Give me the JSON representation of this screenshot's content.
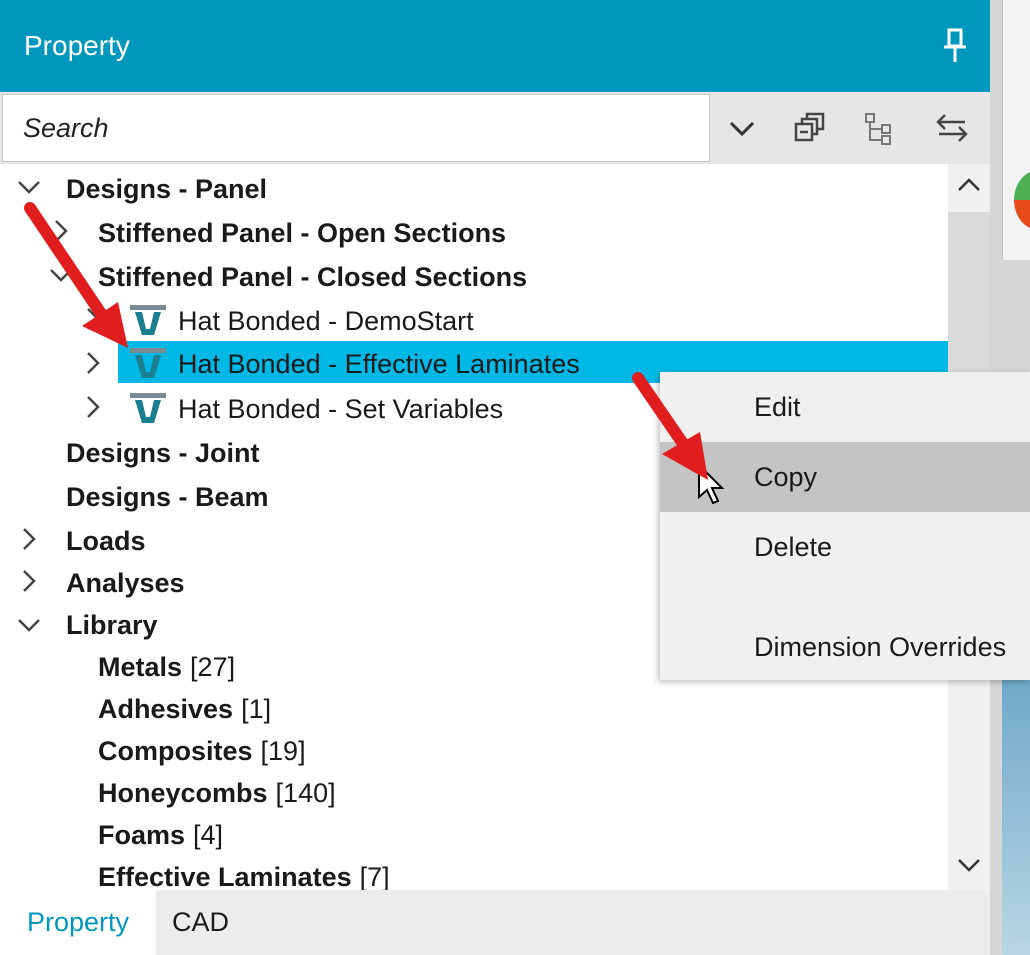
{
  "panel": {
    "title": "Property"
  },
  "search": {
    "placeholder": "Search"
  },
  "tree": {
    "designs_panel": "Designs - Panel",
    "open_sections": "Stiffened Panel - Open Sections",
    "closed_sections": "Stiffened Panel - Closed Sections",
    "hat_demostart": "Hat Bonded - DemoStart",
    "hat_effective": "Hat Bonded - Effective Laminates",
    "hat_setvars": "Hat Bonded - Set Variables",
    "designs_joint": "Designs - Joint",
    "designs_beam": "Designs - Beam",
    "loads": "Loads",
    "analyses": "Analyses",
    "library": "Library",
    "library_items": [
      {
        "label": "Metals",
        "count": "[27]"
      },
      {
        "label": "Adhesives",
        "count": "[1]"
      },
      {
        "label": "Composites",
        "count": "[19]"
      },
      {
        "label": "Honeycombs",
        "count": "[140]"
      },
      {
        "label": "Foams",
        "count": "[4]"
      },
      {
        "label": "Effective Laminates",
        "count": "[7]"
      }
    ]
  },
  "context_menu": {
    "items": [
      "Edit",
      "Copy",
      "Delete",
      "Dimension Overrides"
    ],
    "highlighted": "Copy"
  },
  "tabs": [
    "Property",
    "CAD"
  ],
  "colors": {
    "header": "#0097bd",
    "selection": "#00b8e6",
    "arrow": "#e01e1e",
    "menu_highlight": "#c4c4c4"
  }
}
